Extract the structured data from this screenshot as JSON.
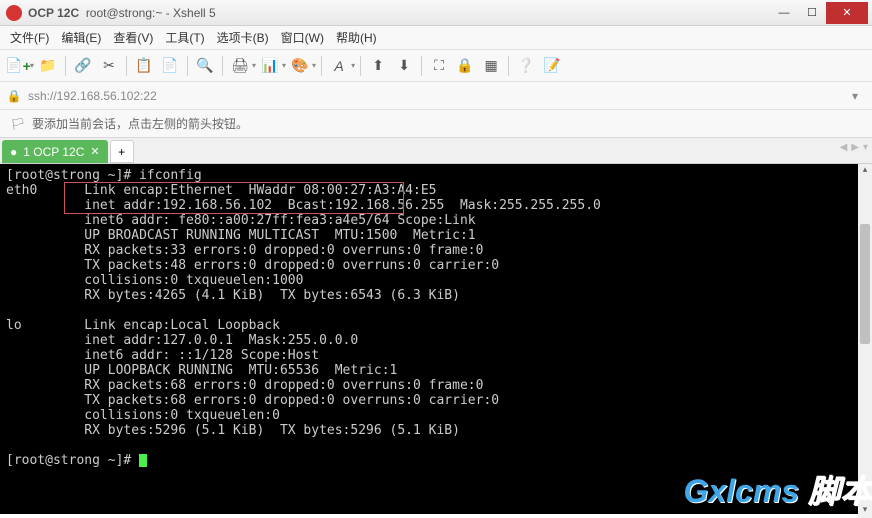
{
  "titlebar": {
    "app_name": "OCP 12C",
    "subtitle": "root@strong:~ - Xshell 5"
  },
  "menubar": {
    "items": [
      "文件(F)",
      "编辑(E)",
      "查看(V)",
      "工具(T)",
      "选项卡(B)",
      "窗口(W)",
      "帮助(H)"
    ]
  },
  "addressbar": {
    "text": "ssh://192.168.56.102:22"
  },
  "hintbar": {
    "text": "要添加当前会话，点击左侧的箭头按钮。"
  },
  "tab": {
    "label": "1 OCP 12C"
  },
  "terminal": {
    "prompt1": "[root@strong ~]# ifconfig",
    "eth0": {
      "name": "eth0",
      "l1": "Link encap:Ethernet  HWaddr 08:00:27:A3:A4:E5",
      "l2": "inet addr:192.168.56.102  Bcast:192.168.56.255  Mask:255.255.255.0",
      "l3": "inet6 addr: fe80::a00:27ff:fea3:a4e5/64 Scope:Link",
      "l4": "UP BROADCAST RUNNING MULTICAST  MTU:1500  Metric:1",
      "l5": "RX packets:33 errors:0 dropped:0 overruns:0 frame:0",
      "l6": "TX packets:48 errors:0 dropped:0 overruns:0 carrier:0",
      "l7": "collisions:0 txqueuelen:1000",
      "l8": "RX bytes:4265 (4.1 KiB)  TX bytes:6543 (6.3 KiB)"
    },
    "lo": {
      "name": "lo",
      "l1": "Link encap:Local Loopback",
      "l2": "inet addr:127.0.0.1  Mask:255.0.0.0",
      "l3": "inet6 addr: ::1/128 Scope:Host",
      "l4": "UP LOOPBACK RUNNING  MTU:65536  Metric:1",
      "l5": "RX packets:68 errors:0 dropped:0 overruns:0 frame:0",
      "l6": "TX packets:68 errors:0 dropped:0 overruns:0 carrier:0",
      "l7": "collisions:0 txqueuelen:0",
      "l8": "RX bytes:5296 (5.1 KiB)  TX bytes:5296 (5.1 KiB)"
    },
    "prompt2": "[root@strong ~]# "
  },
  "watermark": {
    "brand": "Gxlcms",
    "suffix": "脚本"
  }
}
